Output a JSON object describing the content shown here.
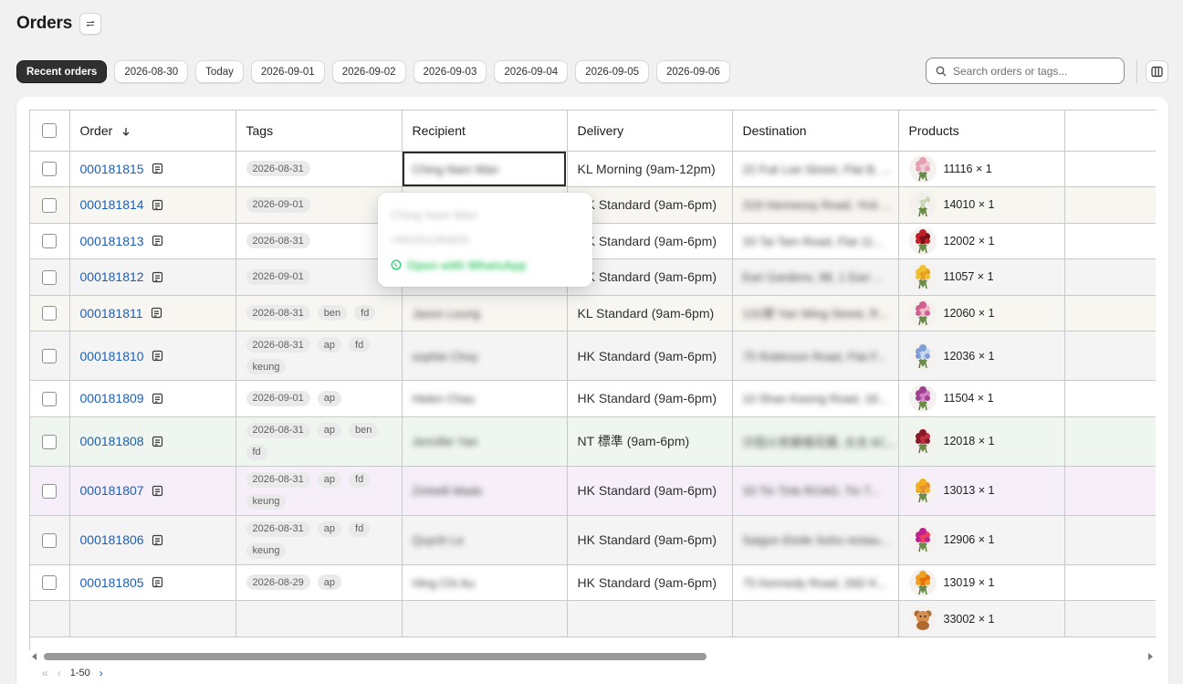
{
  "page": {
    "title": "Orders"
  },
  "filters": [
    "Recent orders",
    "2026-08-30",
    "Today",
    "2026-09-01",
    "2026-09-02",
    "2026-09-03",
    "2026-09-04",
    "2026-09-05",
    "2026-09-06"
  ],
  "active_filter": "Recent orders",
  "search": {
    "placeholder": "Search orders or tags..."
  },
  "table": {
    "headers": {
      "order": "Order",
      "tags": "Tags",
      "recipient": "Recipient",
      "delivery": "Delivery",
      "destination": "Destination",
      "products": "Products"
    },
    "rows": [
      {
        "order": "000181815",
        "tags": [
          "2026-08-31"
        ],
        "recipient": "Ching Nam Wan",
        "delivery": "KL Morning (9am-12pm)",
        "destination": "22 Fuk Lee Street, Flat B, ...",
        "product": "11116 × 1",
        "flower": "pink",
        "style": "row-a"
      },
      {
        "order": "000181814",
        "tags": [
          "2026-09-01"
        ],
        "recipient": "",
        "delivery": "HK Standard (9am-6pm)",
        "destination": "318 Hennessy Road, Yick ...",
        "product": "14010 × 1",
        "flower": "white",
        "style": "row-b"
      },
      {
        "order": "000181813",
        "tags": [
          "2026-08-31"
        ],
        "recipient": "",
        "delivery": "HK Standard (9am-6pm)",
        "destination": "33 Tai Tam Road, Flat 11...",
        "product": "12002 × 1",
        "flower": "red",
        "style": "row-a"
      },
      {
        "order": "000181812",
        "tags": [
          "2026-09-01"
        ],
        "recipient": "",
        "delivery": "HK Standard (9am-6pm)",
        "destination": "Eari Gardens, 88, 1 Eari ...",
        "product": "11057 × 1",
        "flower": "yellow",
        "style": "row-c"
      },
      {
        "order": "000181811",
        "tags": [
          "2026-08-31",
          "ben",
          "fd"
        ],
        "recipient": "Jason Leung",
        "delivery": "KL Standard (9am-6pm)",
        "destination": "131號 Yan Wing Street, R...",
        "product": "12060 × 1",
        "flower": "mixed",
        "style": "row-b"
      },
      {
        "order": "000181810",
        "tags": [
          "2026-08-31",
          "ap",
          "fd",
          "keung"
        ],
        "recipient": "sophie Choy",
        "delivery": "HK Standard (9am-6pm)",
        "destination": "75 Robinson Road, Flat F...",
        "product": "12036 × 1",
        "flower": "blue",
        "style": "row-c"
      },
      {
        "order": "000181809",
        "tags": [
          "2026-09-01",
          "ap"
        ],
        "recipient": "Helen Chau",
        "delivery": "HK Standard (9am-6pm)",
        "destination": "10 Shan Kwong Road, 18...",
        "product": "11504 × 1",
        "flower": "purple",
        "style": "row-a"
      },
      {
        "order": "000181808",
        "tags": [
          "2026-08-31",
          "ap",
          "ben",
          "fd"
        ],
        "recipient": "Jennifer Yan",
        "delivery": "NT 標準 (9am-6pm)",
        "destination": "沙田火炭銀禧花園, 太合 8C...",
        "product": "12018 × 1",
        "flower": "darkred",
        "style": "row-green"
      },
      {
        "order": "000181807",
        "tags": [
          "2026-08-31",
          "ap",
          "fd",
          "keung"
        ],
        "recipient": "Zinhelli Mads",
        "delivery": "HK Standard (9am-6pm)",
        "destination": "33 Tin Tinb ROAD, Tin T...",
        "product": "13013 × 1",
        "flower": "sun",
        "style": "row-purple"
      },
      {
        "order": "000181806",
        "tags": [
          "2026-08-31",
          "ap",
          "fd",
          "keung"
        ],
        "recipient": "Quynh Le",
        "delivery": "HK Standard (9am-6pm)",
        "destination": "Saigon Etoile Soho restau...",
        "product": "12906 × 1",
        "flower": "magenta",
        "style": "row-c"
      },
      {
        "order": "000181805",
        "tags": [
          "2026-08-29",
          "ap"
        ],
        "recipient": "Hing Chi Au",
        "delivery": "HK Standard (9am-6pm)",
        "destination": "75 Kennedy Road, 26D K...",
        "product": "13019 × 1",
        "flower": "orange",
        "style": "row-a"
      }
    ],
    "extra_products": [
      {
        "product": "33002 × 1",
        "flower": "bear"
      }
    ]
  },
  "popover": {
    "name": "Ching Nam Wan",
    "phone": "+85291180820",
    "action": "Open with WhatsApp"
  },
  "pagination": {
    "range": "1-50"
  },
  "colors": {
    "link": "#1f5fb4",
    "whatsapp": "#25d366",
    "active_chip": "#303030"
  }
}
